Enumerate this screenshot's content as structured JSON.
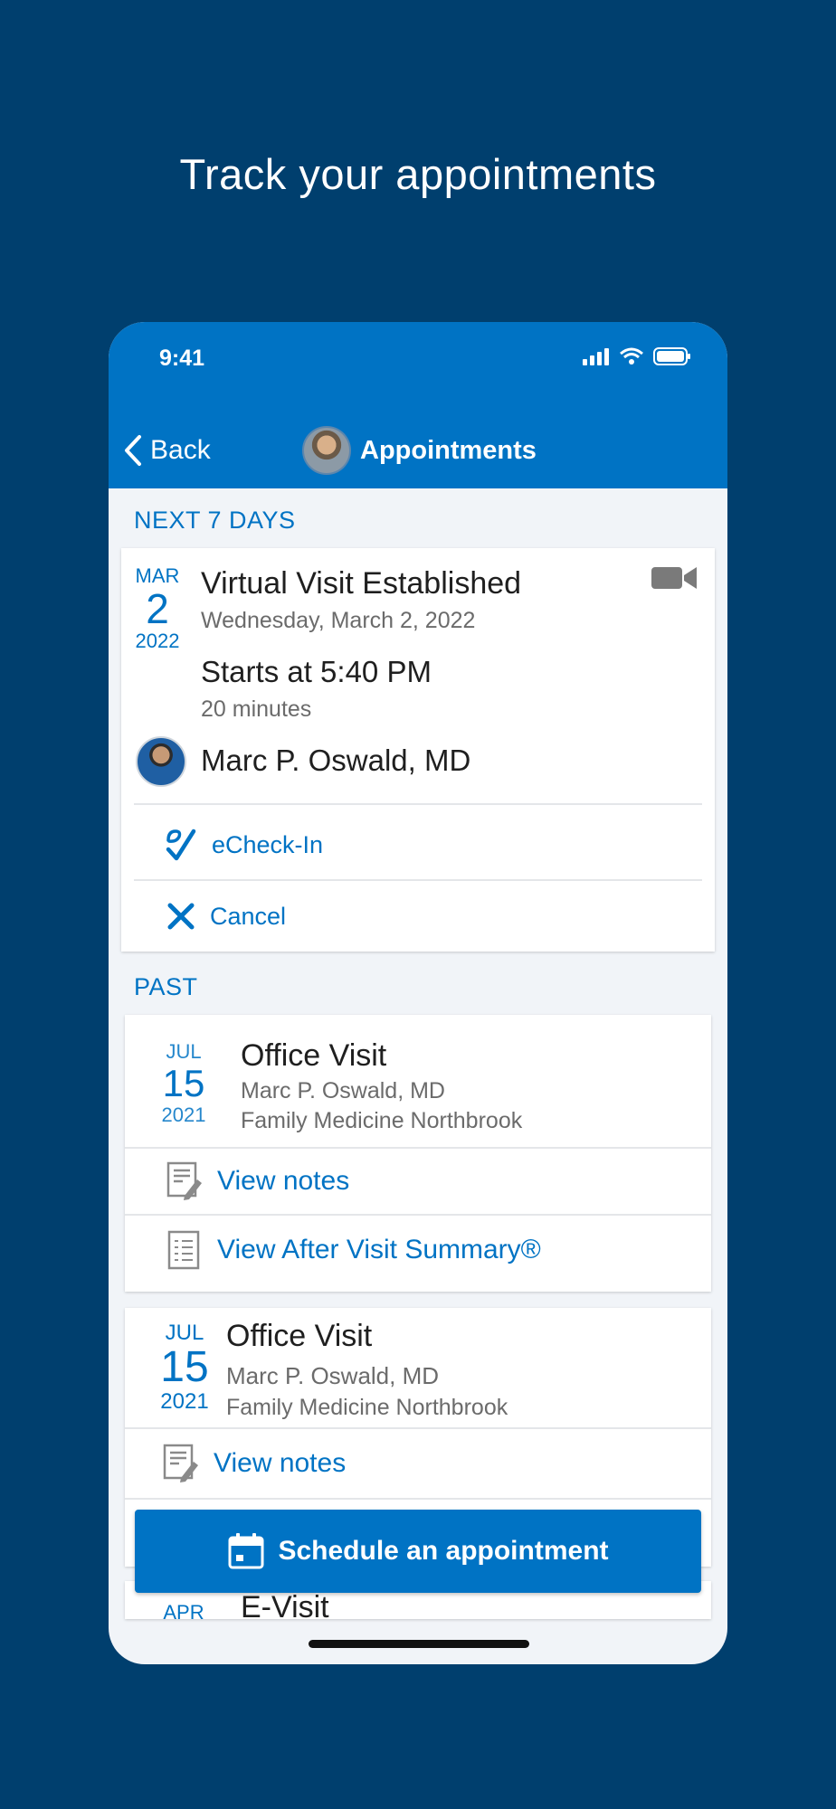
{
  "headline": "Track your appointments",
  "status_bar": {
    "time": "9:41"
  },
  "nav": {
    "back_label": "Back",
    "title": "Appointments"
  },
  "upcoming": {
    "section_label": "NEXT 7 DAYS",
    "appointment": {
      "month": "MAR",
      "day": "2",
      "year": "2022",
      "title": "Virtual Visit Established",
      "date_text": "Wednesday, March 2, 2022",
      "start_text": "Starts at 5:40 PM",
      "duration": "20 minutes",
      "provider": "Marc P. Oswald, MD",
      "type_icon": "video-camera-icon",
      "actions": {
        "echeckin": "eCheck-In",
        "cancel": "Cancel"
      }
    }
  },
  "past": {
    "section_label": "PAST",
    "appointments": [
      {
        "month": "JUL",
        "day": "15",
        "year": "2021",
        "title": "Office Visit",
        "provider": "Marc P. Oswald, MD",
        "department": "Family Medicine Northbrook",
        "actions": {
          "notes": "View notes",
          "avs": "View After Visit Summary®"
        }
      },
      {
        "month": "JUL",
        "day": "15",
        "year": "2021",
        "title": "Office Visit",
        "provider": "Marc P. Oswald, MD",
        "department": "Family Medicine Northbrook",
        "actions": {
          "notes": "View notes"
        }
      },
      {
        "month": "APR",
        "title": "E-Visit"
      }
    ]
  },
  "schedule_button": "Schedule an appointment",
  "colors": {
    "page_bg": "#003f6e",
    "accent": "#0073c4",
    "screen_bg": "#f1f4f8"
  }
}
